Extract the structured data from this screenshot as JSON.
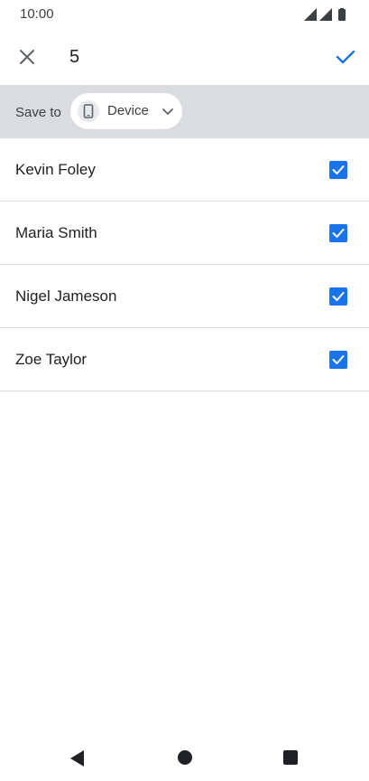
{
  "status_bar": {
    "time": "10:00",
    "icons": [
      "signal-icon",
      "signal-icon",
      "battery-icon"
    ]
  },
  "app_bar": {
    "close_icon": "close-icon",
    "title": "5",
    "done_icon": "check-icon",
    "accent_color": "#1a73e8"
  },
  "save_bar": {
    "label": "Save to",
    "chip_icon": "phone-icon",
    "chip_label": "Device",
    "chip_caret": "chevron-down-icon"
  },
  "contacts": [
    {
      "name": "Kevin Foley",
      "checked": true
    },
    {
      "name": "Maria Smith",
      "checked": true
    },
    {
      "name": "Nigel Jameson",
      "checked": true
    },
    {
      "name": "Zoe Taylor",
      "checked": true
    }
  ],
  "nav_bar": {
    "icons": [
      "back-icon",
      "home-icon",
      "recents-icon"
    ]
  }
}
